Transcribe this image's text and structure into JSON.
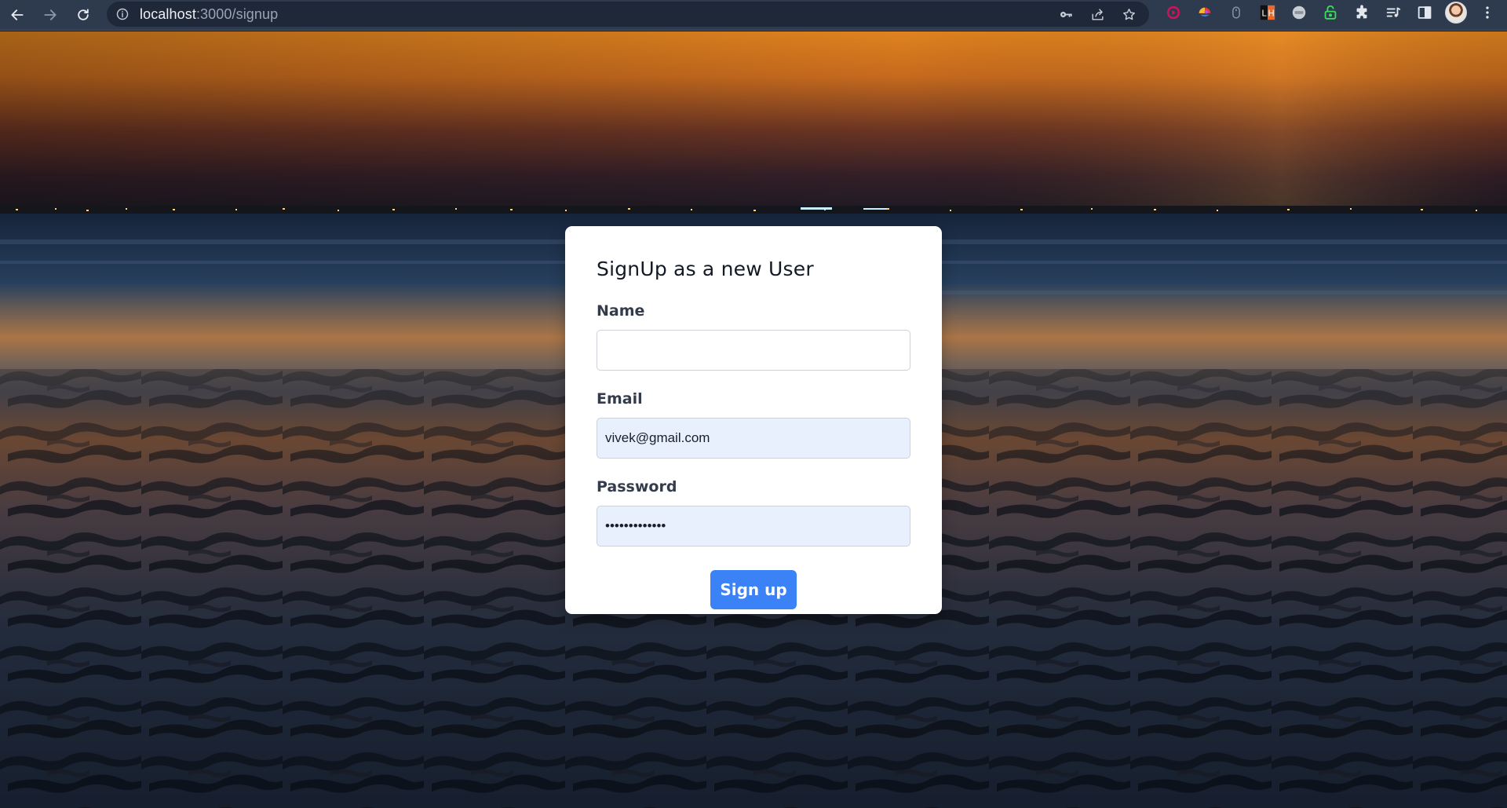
{
  "browser": {
    "url_host": "localhost",
    "url_path": ":3000/signup",
    "nav": {
      "back": "arrow-left-icon",
      "forward": "arrow-right-icon",
      "reload": "reload-icon"
    },
    "omnibox_icons": [
      "key-icon",
      "share-icon",
      "star-icon"
    ],
    "extensions": [
      "record-icon",
      "colorful-extension-icon",
      "mouse-icon",
      "lh-extension-icon",
      "cookie-extension-icon",
      "lock-extension-icon",
      "puzzle-icon",
      "media-queue-icon",
      "side-panel-icon"
    ],
    "lh_text": "LH"
  },
  "form": {
    "title": "SignUp as a new User",
    "name_label": "Name",
    "name_value": "",
    "email_label": "Email",
    "email_value": "vivek@gmail.com",
    "password_label": "Password",
    "password_value": "•••••••••••••",
    "submit_label": "Sign up"
  },
  "colors": {
    "chrome_bg": "#2e3a4d",
    "primary_button": "#3b82f6",
    "autofill_bg": "#e8f0fe"
  }
}
